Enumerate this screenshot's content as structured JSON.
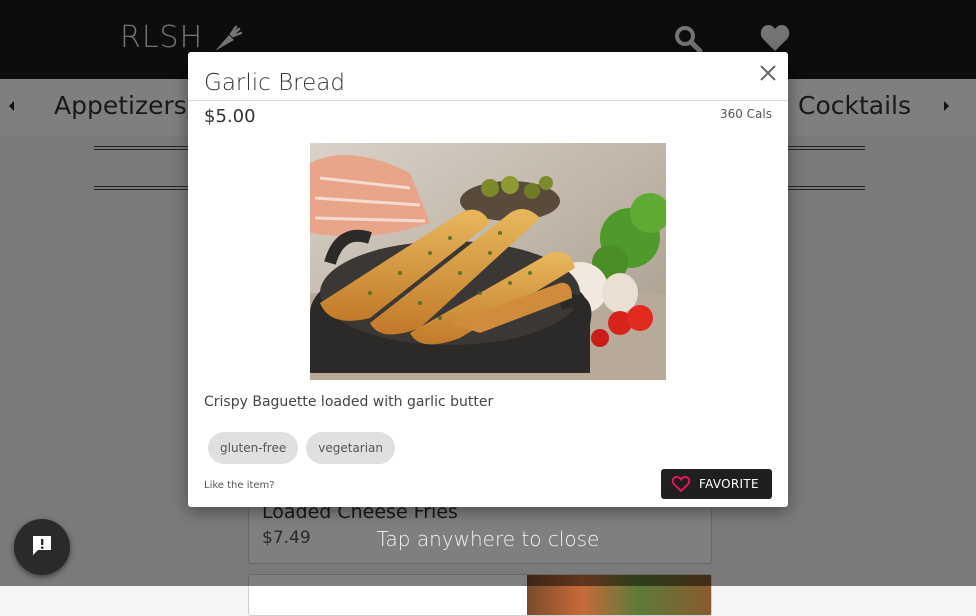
{
  "header": {
    "brand": "RLSH",
    "brand_icon": "carrot-icon",
    "search_icon": "search-icon",
    "favorites_icon": "heart-icon"
  },
  "categories": {
    "visible_left": "Appetizers",
    "visible_right": "Cocktails"
  },
  "background_menu": {
    "items": [
      {
        "name": "Loaded Cheese Fries",
        "price": "$7.49"
      }
    ]
  },
  "modal": {
    "title": "Garlic Bread",
    "price": "$5.00",
    "calories": "360 Cals",
    "description": "Crispy Baguette loaded with garlic butter",
    "tags": [
      "gluten-free",
      "vegetarian"
    ],
    "like_prompt": "Like the item?",
    "favorite_label": "FAVORITE",
    "favorite_accent": "#e8175d"
  },
  "overlay": {
    "close_hint": "Tap anywhere to close"
  },
  "feedback_button": {
    "icon": "feedback-icon"
  }
}
